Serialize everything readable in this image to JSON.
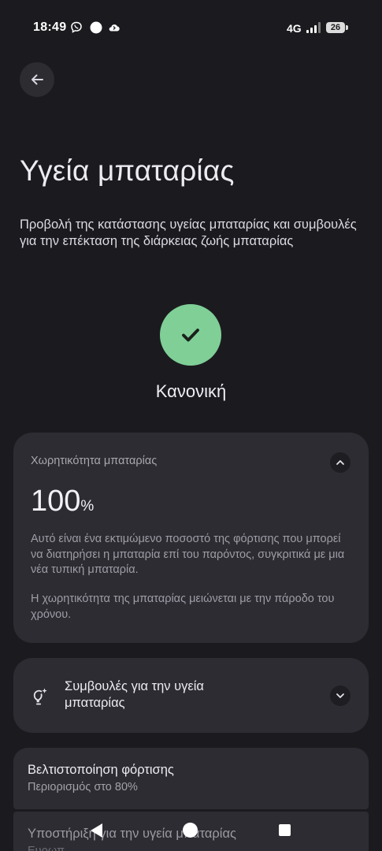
{
  "status_bar": {
    "time": "18:49",
    "network": "4G",
    "battery": "26"
  },
  "header": {
    "title": "Υγεία μπαταρίας",
    "description": "Προβολή της κατάστασης υγείας μπαταρίας και συμβουλές για την επέκταση της διάρκειας ζωής μπαταρίας"
  },
  "status": {
    "label": "Κανονική",
    "color": "#7fcf97"
  },
  "capacity": {
    "label": "Χωρητικότητα μπαταρίας",
    "value": "100",
    "unit": "%",
    "text1": "Αυτό είναι ένα εκτιμώμενο ποσοστό της φόρτισης που μπορεί να διατηρήσει η μπαταρία επί του παρόντος, συγκριτικά με μια νέα τυπική μπαταρία.",
    "text2": "Η χωρητικότητα της μπαταρίας μειώνεται με την πάροδο του χρόνου."
  },
  "tips": {
    "label": "Συμβουλές για την υγεία μπαταρίας"
  },
  "charging": {
    "title": "Βελτιστοποίηση φόρτισης",
    "subtitle": "Περιορισμός στο 80%"
  },
  "support": {
    "title": "Υποστήριξη για την υγεία μπαταρίας",
    "subtitle": "Ευρωπ..."
  },
  "icons": {
    "back": "arrow-left-icon",
    "check": "check-icon",
    "collapse": "chevron-up-icon",
    "expand": "chevron-down-icon",
    "tips": "lightbulb-sparkle-icon"
  }
}
